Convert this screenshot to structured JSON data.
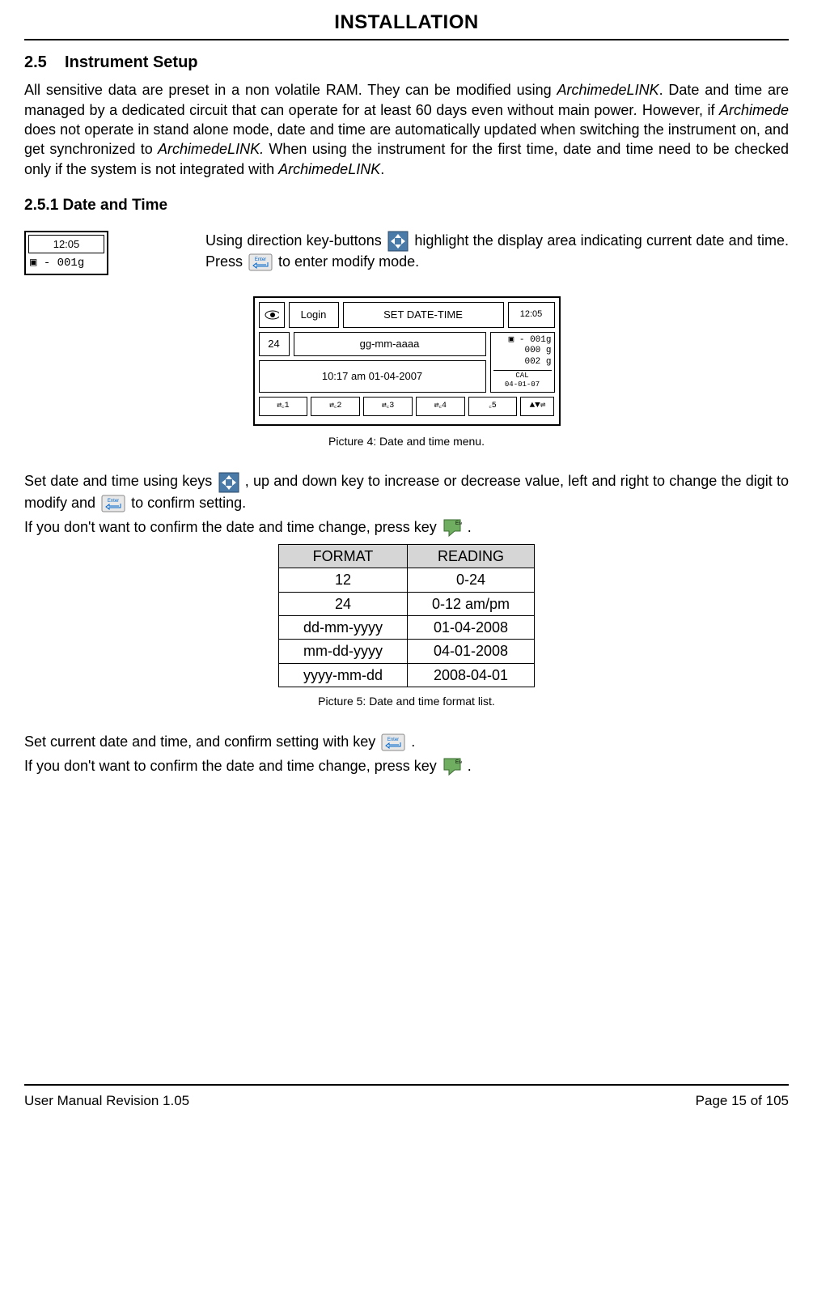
{
  "header": {
    "title": "INSTALLATION"
  },
  "section": {
    "num": "2.5",
    "title": "Instrument Setup",
    "para": "All sensitive data are preset in a non volatile RAM. They can be modified using ArchimedeLINK. Date and time are managed by a dedicated circuit that can operate for at least 60 days even without main power. However, if Archimede does not operate in stand alone mode, date and time are automatically updated when switching the instrument on, and get synchronized to ArchimedeLINK. When using the instrument for the first time, date and time need to be checked only if the system is not integrated with ArchimedeLINK."
  },
  "subsection": {
    "num": "2.5.1",
    "title": "Date and Time"
  },
  "mini_lcd": {
    "time": "12:05",
    "weight": "▣ - 001g"
  },
  "intro": {
    "line1a": "Using direction key-buttons ",
    "line1b": " highlight the display area indicating current date and time. Press ",
    "line1c": " to enter modify mode."
  },
  "caption4": "Picture 4: Date and time menu.",
  "lcd": {
    "login": "Login",
    "title": "SET DATE-TIME",
    "clock": "12:05",
    "val24": "24",
    "format": "gg-mm-aaaa",
    "datetime": "10:17 am 01-04-2007",
    "w1": "▣ - 001g",
    "w2": "000 g",
    "w3": "002 g",
    "cal_label": "CAL",
    "cal_date": "04-01-07",
    "tabs": [
      "⇄꜀1",
      "⇄꜀2",
      "⇄꜀3",
      "⇄꜀4",
      "꜀5"
    ],
    "arrows": "▲▼⇌"
  },
  "para2": {
    "a": "Set date and time using keys ",
    "b": " , up and down key to increase or decrease value, left and right to change the digit to modify and ",
    "c": " to confirm setting.",
    "d": "If you don't want to confirm the date and time change, press key ",
    "e": " ."
  },
  "table": {
    "h1": "FORMAT",
    "h2": "READING",
    "rows": [
      {
        "f": "12",
        "r": "0-24"
      },
      {
        "f": "24",
        "r": "0-12 am/pm"
      },
      {
        "f": "dd-mm-yyyy",
        "r": "01-04-2008"
      },
      {
        "f": "mm-dd-yyyy",
        "r": "04-01-2008"
      },
      {
        "f": "yyyy-mm-dd",
        "r": "2008-04-01"
      }
    ]
  },
  "caption5": "Picture 5: Date and time format list.",
  "para3": {
    "a": "Set current date and time, and confirm setting with key ",
    "b": ".",
    "c": "If you don't want to confirm the date and time change, press key ",
    "d": " ."
  },
  "footer": {
    "left": "User Manual Revision 1.05",
    "right": "Page 15 of 105"
  }
}
